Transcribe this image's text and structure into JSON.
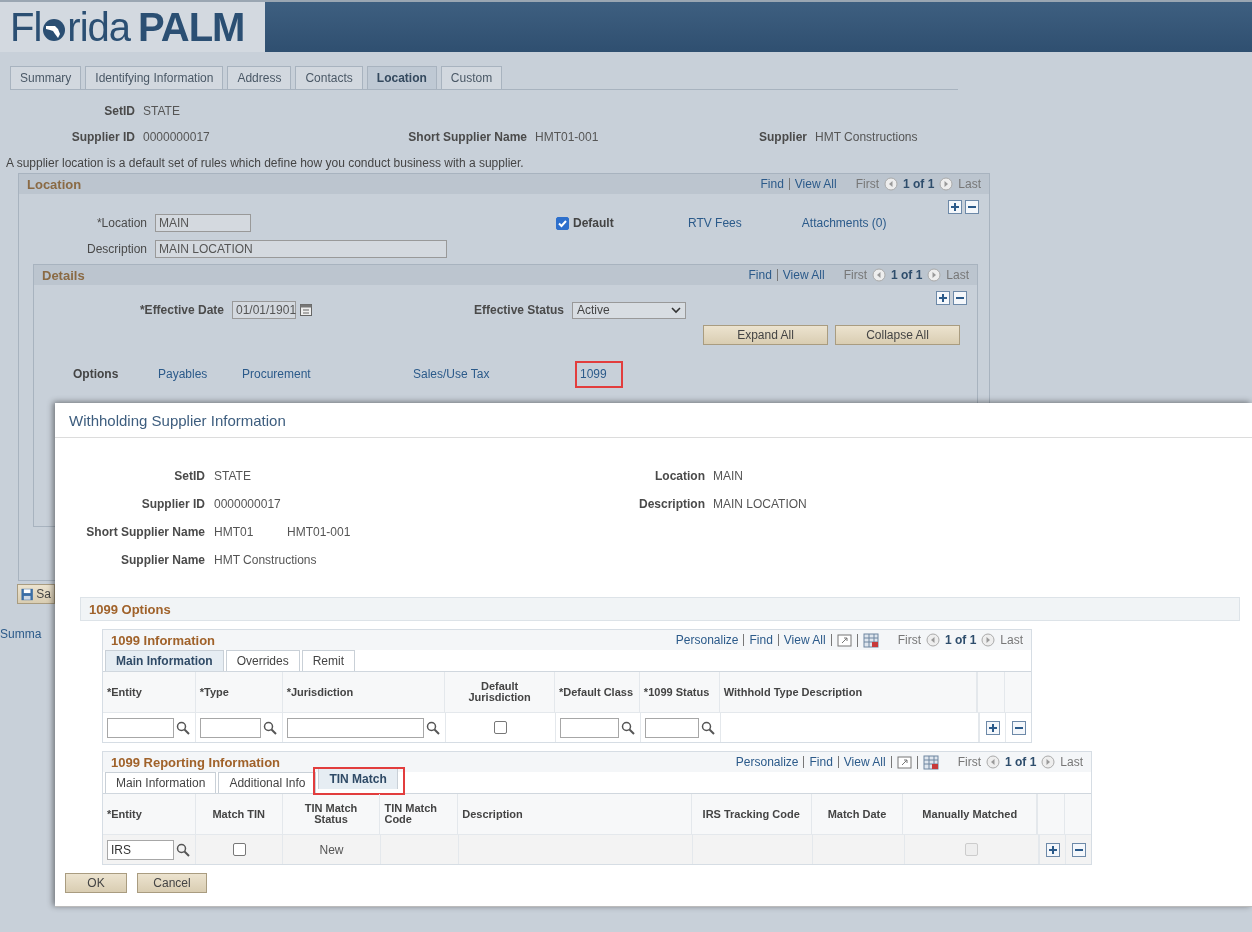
{
  "header": {
    "logo_prefix": "Fl",
    "logo_suffix": "rida",
    "logo_bold": "PALM"
  },
  "tabs": [
    {
      "label": "Summary",
      "selected": false
    },
    {
      "label": "Identifying Information",
      "selected": false
    },
    {
      "label": "Address",
      "selected": false
    },
    {
      "label": "Contacts",
      "selected": false
    },
    {
      "label": "Location",
      "selected": true
    },
    {
      "label": "Custom",
      "selected": false
    }
  ],
  "summary": {
    "setid": {
      "label": "SetID",
      "value": "STATE"
    },
    "supplier_id": {
      "label": "Supplier ID",
      "value": "0000000017"
    },
    "short_name": {
      "label": "Short Supplier Name",
      "value": "HMT01-001"
    },
    "supplier": {
      "label": "Supplier",
      "value": "HMT Constructions"
    }
  },
  "intro": "A supplier location is a default set of rules which define how you conduct business with a supplier.",
  "location_panel": {
    "title": "Location",
    "nav": {
      "find": "Find",
      "view_all": "View All",
      "first": "First",
      "count": "1 of 1",
      "last": "Last"
    },
    "location": {
      "label": "*Location",
      "value": "MAIN"
    },
    "default": {
      "label": "Default",
      "checked": true
    },
    "links": [
      "RTV Fees",
      "Attachments (0)"
    ],
    "description": {
      "label": "Description",
      "value": "MAIN LOCATION"
    },
    "details": {
      "title": "Details",
      "nav": {
        "find": "Find",
        "view_all": "View All",
        "first": "First",
        "count": "1 of 1",
        "last": "Last"
      },
      "effective_date": {
        "label": "*Effective Date",
        "value": "01/01/1901"
      },
      "effective_status": {
        "label": "Effective Status",
        "value": "Active"
      },
      "buttons": [
        "Expand All",
        "Collapse All"
      ],
      "options_label": "Options",
      "options": [
        {
          "label": "Payables",
          "highlighted": false
        },
        {
          "label": "Procurement",
          "highlighted": false
        },
        {
          "label": "Sales/Use Tax",
          "highlighted": false
        },
        {
          "label": "1099",
          "highlighted": true
        }
      ]
    }
  },
  "save_button": "Sa",
  "footer_link": "Summa",
  "dialog": {
    "title": "Withholding Supplier Information",
    "fields": {
      "setid": {
        "label": "SetID",
        "value": "STATE"
      },
      "location": {
        "label": "Location",
        "value": "MAIN"
      },
      "supplier_id": {
        "label": "Supplier ID",
        "value": "0000000017"
      },
      "description": {
        "label": "Description",
        "value": "MAIN LOCATION"
      },
      "short_name": {
        "label": "Short Supplier Name",
        "value": "HMT01",
        "value_2": "HMT01-001"
      },
      "supplier_name": {
        "label": "Supplier Name",
        "value": "HMT Constructions"
      }
    },
    "section_title": "1099 Options",
    "grids": [
      {
        "title": "1099 Information",
        "nav": {
          "personalize": "Personalize",
          "find": "Find",
          "view_all": "View All",
          "first": "First",
          "count": "1 of 1",
          "last": "Last"
        },
        "tabs": [
          {
            "label": "Main Information",
            "selected": true,
            "highlighted": false
          },
          {
            "label": "Overrides",
            "selected": false,
            "highlighted": false
          },
          {
            "label": "Remit",
            "selected": false,
            "highlighted": false
          }
        ],
        "columns": [
          "*Entity",
          "*Type",
          "*Jurisdiction",
          "Default Jurisdiction",
          "*Default Class",
          "*1099 Status",
          "Withhold Type Description"
        ],
        "rows": [
          {
            "cells": [
              {
                "kind": "lookup"
              },
              {
                "kind": "lookup"
              },
              {
                "kind": "lookup"
              },
              {
                "kind": "checkbox",
                "checked": false,
                "disabled": false
              },
              {
                "kind": "lookup"
              },
              {
                "kind": "lookup"
              },
              {
                "kind": "empty"
              }
            ]
          }
        ]
      },
      {
        "title": "1099 Reporting Information",
        "nav": {
          "personalize": "Personalize",
          "find": "Find",
          "view_all": "View All",
          "first": "First",
          "count": "1 of 1",
          "last": "Last"
        },
        "tabs": [
          {
            "label": "Main Information",
            "selected": false,
            "highlighted": false
          },
          {
            "label": "Additional Info",
            "selected": false,
            "highlighted": false
          },
          {
            "label": "TIN Match",
            "selected": true,
            "highlighted": true
          }
        ],
        "columns": [
          "*Entity",
          "Match TIN",
          "TIN Match Status",
          "TIN Match Code",
          "Description",
          "IRS Tracking Code",
          "Match Date",
          "Manually Matched"
        ],
        "rows": [
          {
            "cells": [
              {
                "kind": "lookup",
                "value": "IRS"
              },
              {
                "kind": "checkbox",
                "checked": false,
                "disabled": false
              },
              {
                "kind": "text",
                "value": "New"
              },
              {
                "kind": "empty"
              },
              {
                "kind": "empty"
              },
              {
                "kind": "empty"
              },
              {
                "kind": "empty"
              },
              {
                "kind": "checkbox",
                "checked": false,
                "disabled": true
              }
            ]
          }
        ]
      }
    ],
    "buttons": [
      "OK",
      "Cancel"
    ]
  }
}
